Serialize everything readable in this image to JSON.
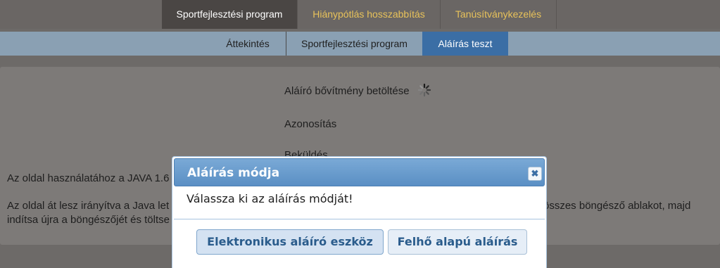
{
  "top_nav": {
    "tabs": [
      {
        "label": "Sportfejlesztési program"
      },
      {
        "label": "Hiánypótlás hosszabbítás"
      },
      {
        "label": "Tanúsítványkezelés"
      }
    ]
  },
  "sub_nav": {
    "tabs": [
      {
        "label": "Áttekintés"
      },
      {
        "label": "Sportfejlesztési program"
      },
      {
        "label": "Aláírás teszt"
      }
    ]
  },
  "content": {
    "steps": [
      {
        "label": "Aláíró bővítmény betöltése"
      },
      {
        "label": "Azonosítás"
      },
      {
        "label": "Beküldés"
      }
    ],
    "para1": "Az oldal használatához a JAVA 1.6",
    "para2_left": "Az oldal át lesz irányítva a Java let",
    "para2_right": "összes böngésző ablakot, majd",
    "para3": "indítsa újra a böngészőjét és töltse"
  },
  "modal": {
    "title": "Aláírás módja",
    "close_glyph": "✖",
    "message": "Válassza ki az aláírás módját!",
    "buttons": {
      "electronic": "Elektronikus aláíró eszköz",
      "cloud": "Felhő alapú aláírás"
    }
  },
  "colors": {
    "accent": "#3b6ea5",
    "tab_text": "#e8c25a"
  }
}
